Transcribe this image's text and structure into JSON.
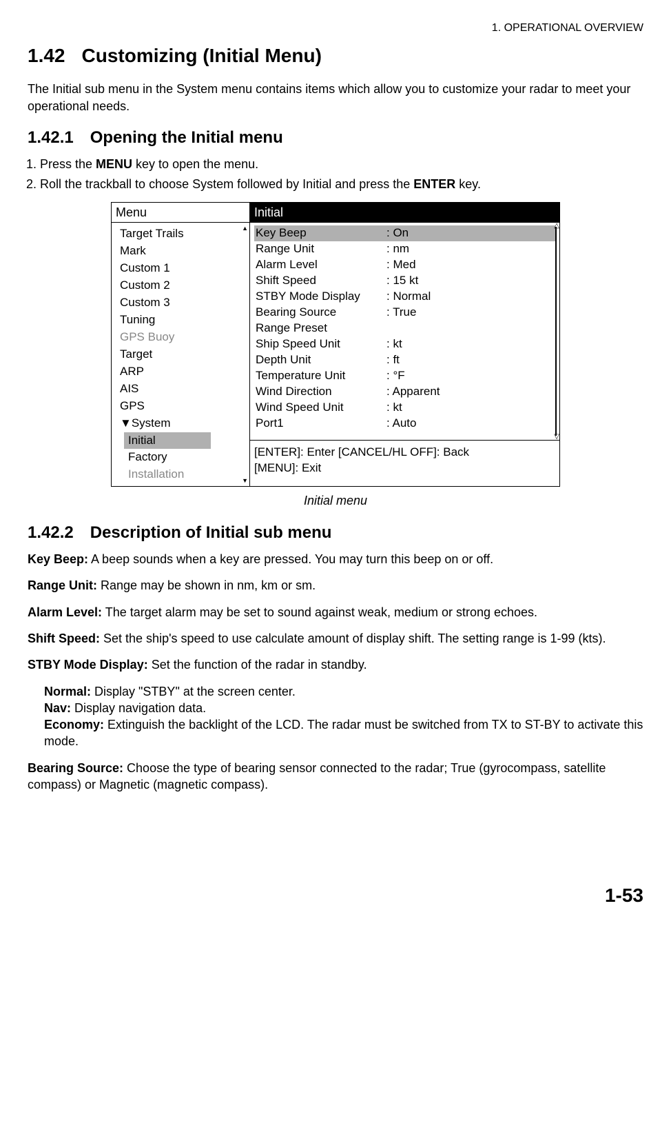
{
  "header": {
    "chapter": "1. OPERATIONAL OVERVIEW"
  },
  "h1": {
    "num": "1.42",
    "title": "Customizing (Initial Menu)"
  },
  "intro": "The Initial sub menu in the System menu contains items which allow you to customize your radar to meet your operational needs.",
  "s1": {
    "num": "1.42.1",
    "title": "Opening the Initial menu",
    "step1_a": "Press the ",
    "step1_b": "MENU",
    "step1_c": " key to open the menu.",
    "step2_a": "Roll the trackball to choose System followed by Initial and press the ",
    "step2_b": "ENTER",
    "step2_c": " key."
  },
  "menu": {
    "leftHeader": "Menu",
    "leftItems": [
      {
        "label": "Target Trails"
      },
      {
        "label": "Mark"
      },
      {
        "label": "Custom 1"
      },
      {
        "label": "Custom 2"
      },
      {
        "label": "Custom 3"
      },
      {
        "label": "Tuning"
      },
      {
        "label": "GPS Buoy",
        "gray": true
      },
      {
        "label": "Target"
      },
      {
        "label": "ARP"
      },
      {
        "label": "AIS"
      },
      {
        "label": "GPS"
      },
      {
        "label": "▼System"
      },
      {
        "label": "Initial",
        "indent": true,
        "sel": true
      },
      {
        "label": "Factory",
        "indent": true
      },
      {
        "label": "Installation",
        "indent": true,
        "gray": true
      }
    ],
    "rightHeader": "Initial",
    "rows": [
      {
        "label": "Key Beep",
        "val": "On",
        "sel": true
      },
      {
        "label": "Range Unit",
        "val": "nm"
      },
      {
        "label": "Alarm Level",
        "val": "Med"
      },
      {
        "label": "Shift Speed",
        "val": "15 kt"
      },
      {
        "label": "STBY Mode Display",
        "val": "Normal"
      },
      {
        "label": "Bearing Source",
        "val": "True"
      },
      {
        "label": "Range Preset",
        "val": ""
      },
      {
        "label": "Ship Speed Unit",
        "val": "kt"
      },
      {
        "label": "Depth Unit",
        "val": "ft"
      },
      {
        "label": "Temperature Unit",
        "val": "°F"
      },
      {
        "label": "Wind Direction",
        "val": "Apparent"
      },
      {
        "label": "Wind Speed Unit",
        "val": "kt"
      },
      {
        "label": "Port1",
        "val": "Auto"
      }
    ],
    "footer1": "[ENTER]: Enter  [CANCEL/HL OFF]: Back",
    "footer2": "[MENU]: Exit",
    "caption": "Initial menu"
  },
  "s2": {
    "num": "1.42.2",
    "title": "Description of Initial sub menu"
  },
  "desc": {
    "keyBeepT": "Key Beep:",
    "keyBeep": " A beep sounds when a key are pressed. You may turn this beep on or off.",
    "rangeUnitT": "Range Unit:",
    "rangeUnit": " Range may be shown in nm, km or sm.",
    "alarmT": "Alarm Level:",
    "alarm": " The target alarm may be set to sound against weak, medium or strong echoes.",
    "shiftT": "Shift Speed:",
    "shift": " Set the ship's speed to use calculate amount of display shift. The setting range is 1-99 (kts).",
    "stbyT": "STBY Mode Display:",
    "stby": " Set the function of the radar in standby.",
    "normalT": "Normal:",
    "normal": " Display \"STBY\" at the screen center.",
    "navT": "Nav:",
    "nav": " Display navigation data.",
    "econT": "Economy:",
    "econ": " Extinguish the backlight of the LCD. The radar must be switched from TX to ST-BY to activate this mode.",
    "bearingT": "Bearing Source:",
    "bearing": " Choose the type of bearing sensor connected to the radar; True (gyrocompass, satellite compass) or Magnetic (magnetic compass)."
  },
  "pageNum": "1-53"
}
